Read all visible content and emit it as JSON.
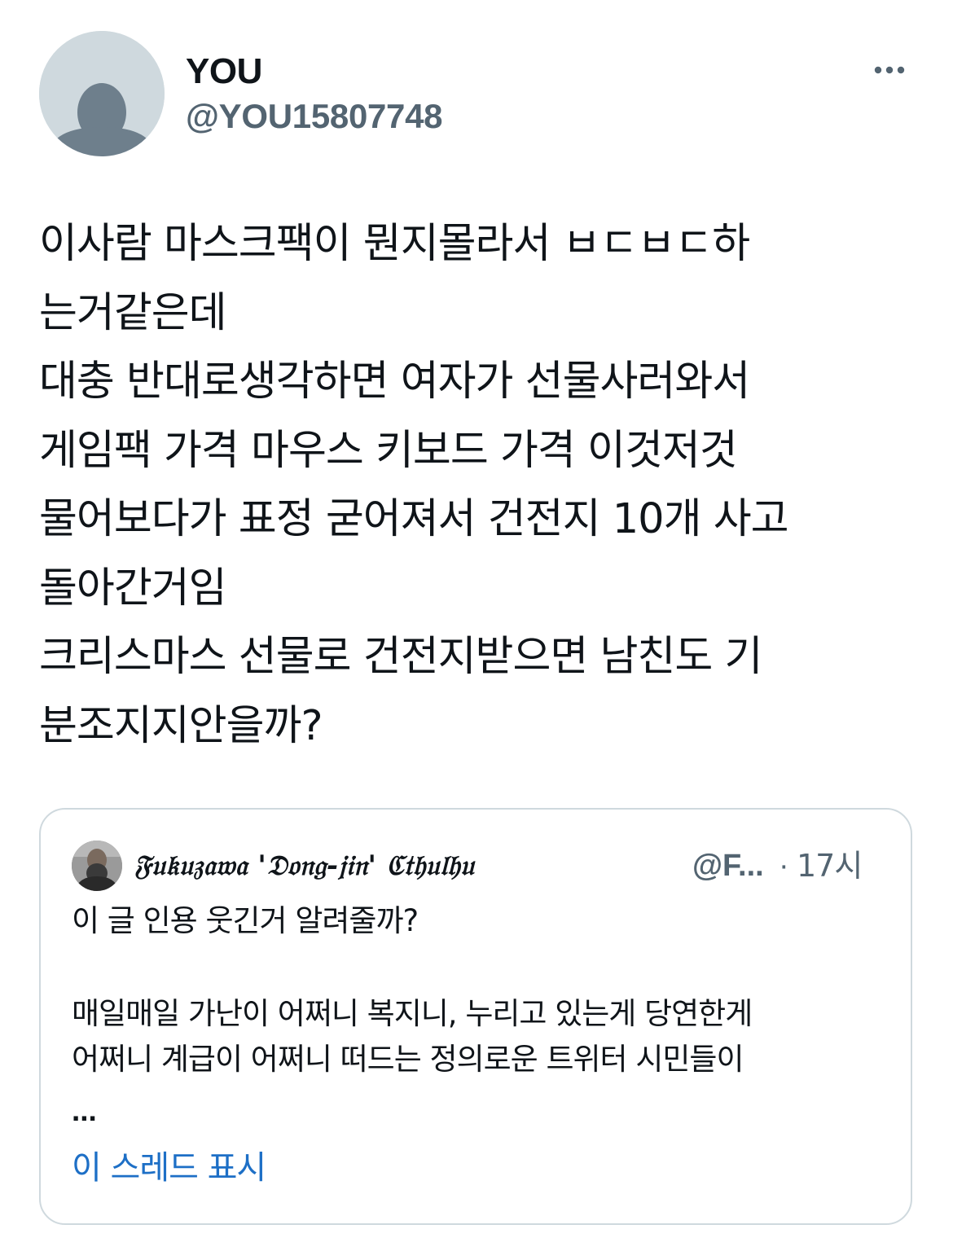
{
  "author": {
    "display_name": "YOU",
    "handle": "@YOU15807748",
    "avatar_icon": "default-profile-silhouette-icon"
  },
  "menu": {
    "more_icon": "more-horizontal-icon"
  },
  "tweet": {
    "lines": [
      "이사람 마스크팩이 뭔지몰라서 ㅂㄷㅂㄷ하",
      "는거같은데",
      "대충 반대로생각하면 여자가 선물사러와서",
      "게임팩 가격 마우스 키보드 가격 이것저것",
      "물어보다가 표정 굳어져서 건전지 10개 사고",
      "돌아간거임",
      "크리스마스 선물로 건전지받으면 남친도 기",
      "분조지지안을까?"
    ]
  },
  "quoted_tweet": {
    "author_name": "𝔉𝔲𝔨𝔲𝔷𝔞𝔴𝔞 '𝔇𝔬𝔫𝔤-𝔧𝔦𝔫' ℭ𝔱𝔥𝔲𝔩𝔥𝔲",
    "handle": "@F...",
    "separator": "·",
    "time": "17시",
    "line1": "이 글 인용 웃긴거 알려줄까?",
    "line2": "매일매일 가난이 어쩌니 복지니, 누리고 있는게 당연한게",
    "line3": "어쩌니 계급이 어쩌니 떠드는 정의로운 트위터 시민들이",
    "ellipsis": "...",
    "show_thread": "이 스레드 표시"
  },
  "colors": {
    "text_primary": "#0f1419",
    "text_secondary": "#536471",
    "link": "#1d6fc6",
    "border": "#cfd9de",
    "avatar_bg": "#cfd9de",
    "avatar_fg": "#6e7f8c"
  }
}
